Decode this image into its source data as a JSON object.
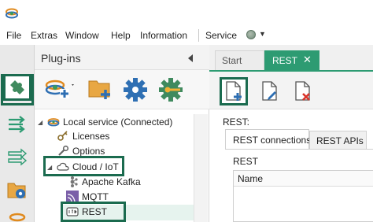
{
  "menu": {
    "items": [
      "File",
      "Extras",
      "Window",
      "Help",
      "Information",
      "Service"
    ]
  },
  "plugins_panel": {
    "title": "Plug-ins",
    "tree": [
      {
        "label": "Local service (Connected)",
        "icon": "local-service-icon"
      },
      {
        "label": "Licenses",
        "icon": "key-icon"
      },
      {
        "label": "Options",
        "icon": "wrench-icon"
      },
      {
        "label": "Cloud / IoT",
        "icon": "cloud-icon"
      },
      {
        "label": "Apache Kafka",
        "icon": "kafka-icon"
      },
      {
        "label": "MQTT",
        "icon": "mqtt-icon"
      },
      {
        "label": "REST",
        "icon": "rest-icon"
      }
    ]
  },
  "tabs": {
    "start": "Start",
    "rest": "REST",
    "close": "✕"
  },
  "content": {
    "heading": "REST:",
    "subtabs": [
      "REST connections",
      "REST APIs"
    ],
    "section_label": "REST",
    "table_header": "Name"
  },
  "colors": {
    "accent": "#2d9b72",
    "highlight_border": "#1b6b4f"
  }
}
